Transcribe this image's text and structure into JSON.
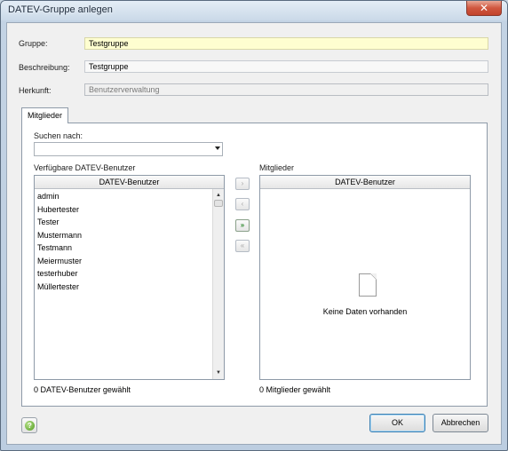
{
  "window": {
    "title": "DATEV-Gruppe anlegen",
    "close_glyph": "✕"
  },
  "form": {
    "gruppe": {
      "label": "Gruppe:",
      "value": "Testgruppe"
    },
    "beschreibung": {
      "label": "Beschreibung:",
      "value": "Testgruppe"
    },
    "herkunft": {
      "label": "Herkunft:",
      "value": "Benutzerverwaltung"
    }
  },
  "tabs": [
    {
      "label": "Mitglieder",
      "selected": true
    }
  ],
  "search": {
    "label": "Suchen nach:",
    "value": ""
  },
  "available": {
    "label": "Verfügbare DATEV-Benutzer",
    "column_header": "DATEV-Benutzer",
    "items": [
      "admin",
      "Hubertester",
      "Tester",
      "Mustermann",
      "Testmann",
      "Meiermuster",
      "testerhuber",
      "Müllertester"
    ],
    "status": "0 DATEV-Benutzer gewählt"
  },
  "members": {
    "label": "Mitglieder",
    "column_header": "DATEV-Benutzer",
    "empty_text": "Keine Daten vorhanden",
    "status": "0 Mitglieder gewählt"
  },
  "transfer_buttons": {
    "add_one": "›",
    "remove_one": "‹",
    "add_all": "»",
    "remove_all": "«"
  },
  "buttons": {
    "help": "?",
    "ok": "OK",
    "cancel": "Abbrechen"
  },
  "colors": {
    "required_field": "#fefed0",
    "add_all_active": "#2f8a2f"
  },
  "icons": {
    "close": "close-icon",
    "help": "help-icon",
    "empty": "empty-document-icon"
  }
}
